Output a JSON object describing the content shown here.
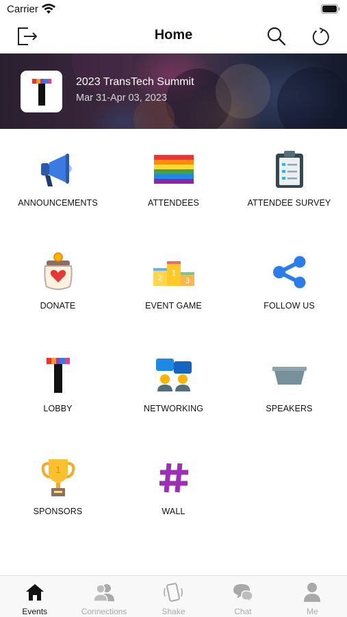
{
  "status_bar": {
    "carrier": "Carrier"
  },
  "nav": {
    "title": "Home"
  },
  "event": {
    "title": "2023 TransTech Summit",
    "dates": "Mar 31-Apr 03, 2023"
  },
  "grid": [
    {
      "label": "ANNOUNCEMENTS",
      "icon": "megaphone-icon"
    },
    {
      "label": "ATTENDEES",
      "icon": "rainbow-flag-icon"
    },
    {
      "label": "ATTENDEE SURVEY",
      "icon": "clipboard-icon"
    },
    {
      "label": "DONATE",
      "icon": "donation-jar-icon"
    },
    {
      "label": "EVENT GAME",
      "icon": "podium-icon"
    },
    {
      "label": "FOLLOW US",
      "icon": "share-icon"
    },
    {
      "label": "LOBBY",
      "icon": "transtech-logo-icon"
    },
    {
      "label": "NETWORKING",
      "icon": "networking-icon"
    },
    {
      "label": "SPEAKERS",
      "icon": "stage-icon"
    },
    {
      "label": "SPONSORS",
      "icon": "trophy-icon"
    },
    {
      "label": "WALL",
      "icon": "hashtag-icon"
    }
  ],
  "tabs": [
    {
      "label": "Events",
      "icon": "home-icon",
      "active": true
    },
    {
      "label": "Connections",
      "icon": "people-icon",
      "active": false
    },
    {
      "label": "Shake",
      "icon": "phone-shake-icon",
      "active": false
    },
    {
      "label": "Chat",
      "icon": "chat-bubbles-icon",
      "active": false
    },
    {
      "label": "Me",
      "icon": "person-icon",
      "active": false
    }
  ],
  "colors": {
    "accent": "#2b7de9",
    "tab_active": "#111111",
    "tab_inactive": "#a9a9a9",
    "wall_purple": "#9b30b4"
  }
}
